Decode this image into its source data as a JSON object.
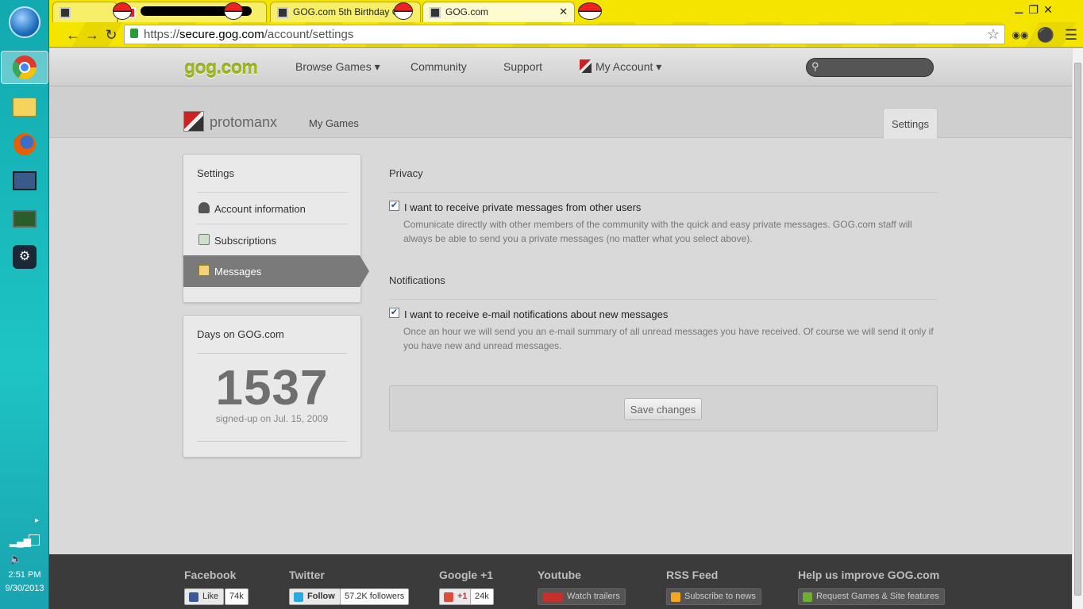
{
  "taskbar": {
    "time": "2:51 PM",
    "date": "9/30/2013",
    "apps": [
      "chrome-icon",
      "file-explorer-icon",
      "firefox-icon",
      "monitor-icon",
      "terminal-icon",
      "steam-icon"
    ]
  },
  "browser": {
    "tabs": [
      {
        "label": ""
      },
      {
        "label": ""
      },
      {
        "label": "GOG.com 5th Birthday G"
      },
      {
        "label": "GOG.com"
      }
    ],
    "url_scheme": "https://",
    "url_host": "secure.gog.com",
    "url_path": "/account/settings"
  },
  "site": {
    "logo": "gog.com",
    "nav": {
      "browse": "Browse Games ▾",
      "community": "Community",
      "support": "Support",
      "account": "My Account ▾"
    }
  },
  "user": {
    "name": "protomanx",
    "my_games": "My Games",
    "settings_tab": "Settings"
  },
  "sidebar": {
    "title": "Settings",
    "items": [
      {
        "label": "Account information"
      },
      {
        "label": "Subscriptions"
      },
      {
        "label": "Messages"
      }
    ]
  },
  "days": {
    "title": "Days on GOG.com",
    "count": "1537",
    "signed_up": "signed-up on Jul. 15, 2009"
  },
  "privacy": {
    "title": "Privacy",
    "checkbox_label": "I want to receive private messages from other users",
    "checked": true,
    "description": "Comunicate directly with other members of the community with the quick and easy private messages. GOG.com staff will always be able to send you a private messages (no matter what you select above)."
  },
  "notifications": {
    "title": "Notifications",
    "checkbox_label": "I want to receive e-mail notifications about new messages",
    "checked": true,
    "description": "Once an hour we will send you an e-mail summary of all unread messages you have received. Of course we will send it only if you have new and unread messages."
  },
  "save_button": "Save changes",
  "footer": {
    "facebook": {
      "title": "Facebook",
      "button": "Like",
      "count": "74k"
    },
    "twitter": {
      "title": "Twitter",
      "button": "Follow",
      "count": "57.2K followers"
    },
    "google": {
      "title": "Google +1",
      "button": "+1",
      "count": "24k"
    },
    "youtube": {
      "title": "Youtube",
      "button": "Watch trailers"
    },
    "rss": {
      "title": "RSS Feed",
      "button": "Subscribe to news"
    },
    "help": {
      "title": "Help us improve GOG.com",
      "button": "Request Games & Site features"
    }
  },
  "colors": {
    "tabstrip": "#f5e400",
    "logo_green": "#9fb81f",
    "footer_bg": "#3b3b3b",
    "active_sidebar": "#7a7a7a"
  }
}
